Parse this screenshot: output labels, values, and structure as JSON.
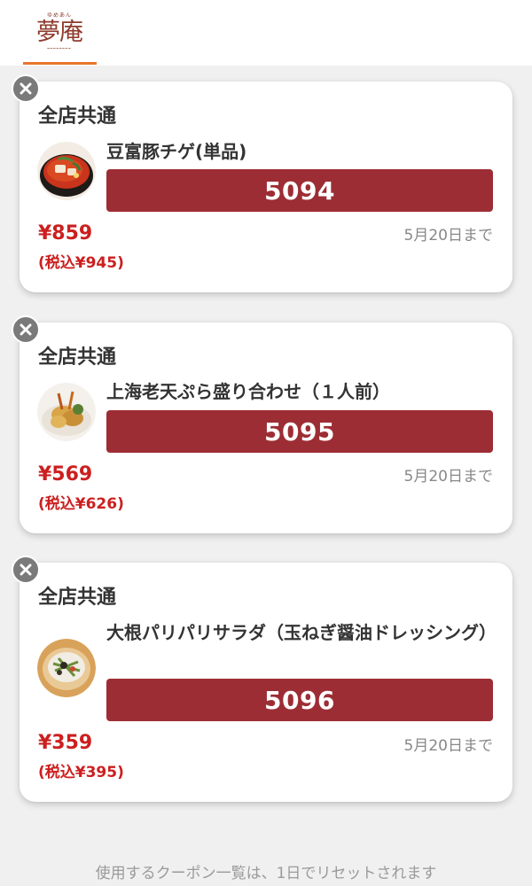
{
  "header": {
    "logo_text": "夢庵",
    "logo_small_text": "ゆめあん",
    "accent_color": "#e8742c",
    "brand_color": "#8e3b2c"
  },
  "coupons": [
    {
      "close_icon": "close-icon",
      "store": "全店共通",
      "image": "tofu-pork-chige-photo",
      "name": "豆富豚チゲ(単品)",
      "code": "5094",
      "price": "¥859",
      "price_tax": "(税込¥945)",
      "expiry": "5月20日まで"
    },
    {
      "close_icon": "close-icon",
      "store": "全店共通",
      "image": "shrimp-tempura-photo",
      "name": "上海老天ぷら盛り合わせ（１人前）",
      "code": "5095",
      "price": "¥569",
      "price_tax": "(税込¥626)",
      "expiry": "5月20日まで"
    },
    {
      "close_icon": "close-icon",
      "store": "全店共通",
      "image": "daikon-salad-photo",
      "name": "大根パリパリサラダ（玉ねぎ醤油ドレッシング）",
      "code": "5096",
      "price": "¥359",
      "price_tax": "(税込¥395)",
      "expiry": "5月20日まで"
    }
  ],
  "code_bar_color": "#9d2d34",
  "price_color": "#cc1f1f",
  "footer": {
    "note": "使用するクーポン一覧は、1日でリセットされます"
  }
}
